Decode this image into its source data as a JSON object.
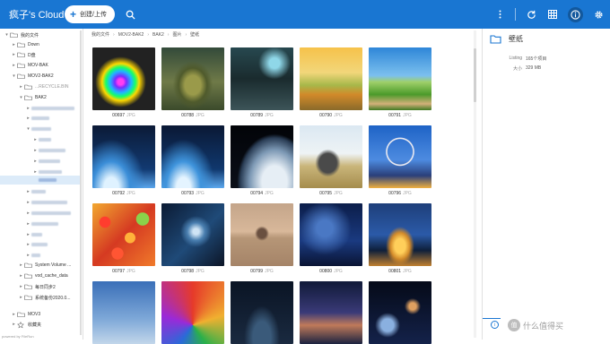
{
  "header": {
    "app_title": "疯子's Cloud",
    "create_label": "创建/上传",
    "icons": [
      "more-vert-icon",
      "refresh-icon",
      "grid-view-icon",
      "info-icon",
      "settings-icon"
    ]
  },
  "sidebar": {
    "items": [
      {
        "label": "我的文件"
      },
      {
        "label": "Down"
      },
      {
        "label": "D盘"
      },
      {
        "label": "MOV-BAK"
      },
      {
        "label": "MOV2-BAK2"
      },
      {
        "label": "...RECYCLE.BIN"
      },
      {
        "label": "BAK2"
      },
      {
        "label": "System Volume ..."
      },
      {
        "label": "vod_cache_data"
      },
      {
        "label": "每日同步2"
      },
      {
        "label": "系统备份2020.0..."
      },
      {
        "label": "MOV3"
      },
      {
        "label": "收藏夹"
      }
    ],
    "powered_by": "powered by FileRun"
  },
  "breadcrumb": [
    "我的文件",
    "MOV2-BAK2",
    "BAK2",
    "图片",
    "壁纸"
  ],
  "files": [
    {
      "name": "00697",
      "ext": "JPG"
    },
    {
      "name": "00788",
      "ext": "JPG"
    },
    {
      "name": "00789",
      "ext": "JPG"
    },
    {
      "name": "00790",
      "ext": "JPG"
    },
    {
      "name": "00791",
      "ext": "JPG"
    },
    {
      "name": "00792",
      "ext": "JPG"
    },
    {
      "name": "00793",
      "ext": "JPG"
    },
    {
      "name": "00794",
      "ext": "JPG"
    },
    {
      "name": "00795",
      "ext": "JPG"
    },
    {
      "name": "00796",
      "ext": "JPG"
    },
    {
      "name": "00797",
      "ext": "JPG"
    },
    {
      "name": "00798",
      "ext": "JPG"
    },
    {
      "name": "00799",
      "ext": "JPG"
    },
    {
      "name": "00800",
      "ext": "JPG"
    },
    {
      "name": "00801",
      "ext": "JPG"
    }
  ],
  "details": {
    "title": "壁纸",
    "listing_label": "Listing",
    "listing_value": "165个项目",
    "size_label": "大小",
    "size_value": "329 MB"
  },
  "watermark": "什么值得买",
  "colors": {
    "accent": "#1976d2"
  }
}
